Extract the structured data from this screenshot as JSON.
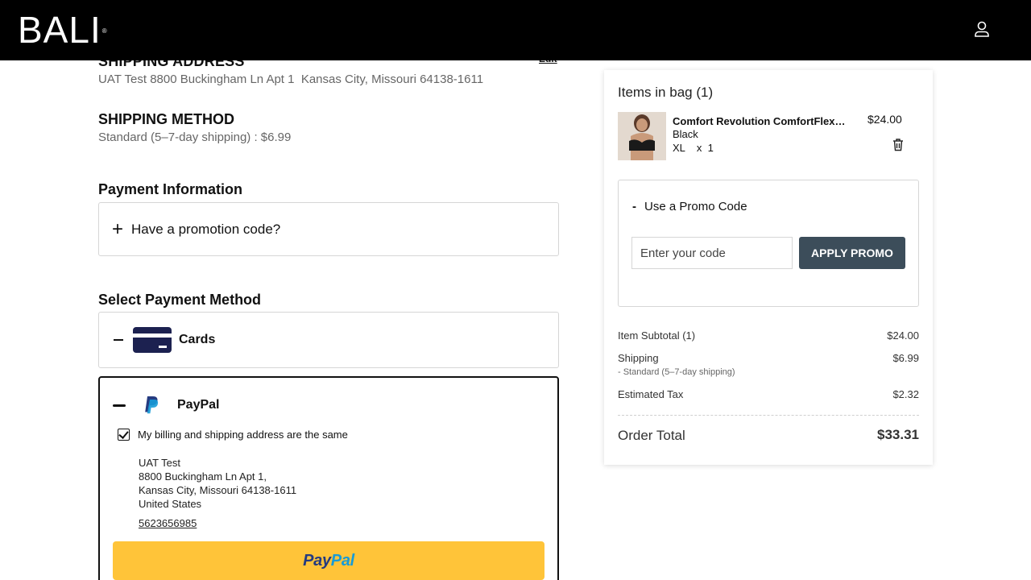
{
  "header": {
    "logo": "BALI",
    "logo_reg": "®"
  },
  "shipping_address": {
    "title": "SHIPPING ADDRESS",
    "edit_label": "Edit",
    "text": "UAT Test 8800 Buckingham Ln Apt 1  Kansas City, Missouri 64138-1611"
  },
  "shipping_method": {
    "title": "SHIPPING METHOD",
    "text": "Standard (5–7-day shipping) : $6.99"
  },
  "payment_info": {
    "title": "Payment Information",
    "promo_toggle": "Have a promotion code?"
  },
  "payment_method": {
    "title": "Select Payment Method",
    "cards_label": "Cards",
    "paypal": {
      "label": "PayPal",
      "same_address_label": "My billing and shipping address are the same",
      "same_address_checked": true,
      "address_lines": [
        "UAT Test",
        "8800 Buckingham Ln Apt 1,",
        "Kansas City, Missouri 64138-1611",
        "United States"
      ],
      "phone": "5623656985",
      "button_part1": "Pay",
      "button_part2": "Pal"
    }
  },
  "bag": {
    "title": "Items in bag (1)",
    "item": {
      "name": "Comfort Revolution ComfortFlex Fit Wireless Bra",
      "color": "Black",
      "size_qty": "XL    x  1",
      "price": "$24.00"
    },
    "promo": {
      "toggle": "Use a Promo Code",
      "placeholder": "Enter your code",
      "apply": "APPLY PROMO"
    },
    "summary": {
      "subtotal_label": "Item Subtotal (1)",
      "subtotal": "$24.00",
      "shipping_label": "Shipping",
      "shipping": "$6.99",
      "shipping_sub": "- Standard (5–7-day shipping)",
      "tax_label": "Estimated Tax",
      "tax": "$2.32",
      "total_label": "Order Total",
      "total": "$33.31"
    }
  },
  "colors": {
    "header_bg": "#000000",
    "card_icon": "#1c2150",
    "paypal_button": "#ffc439",
    "apply_button": "#3c4d5a"
  },
  "icons": [
    "account-icon",
    "plus-icon",
    "minus-icon",
    "credit-card-icon",
    "paypal-logo-icon",
    "check-icon",
    "trash-icon"
  ]
}
